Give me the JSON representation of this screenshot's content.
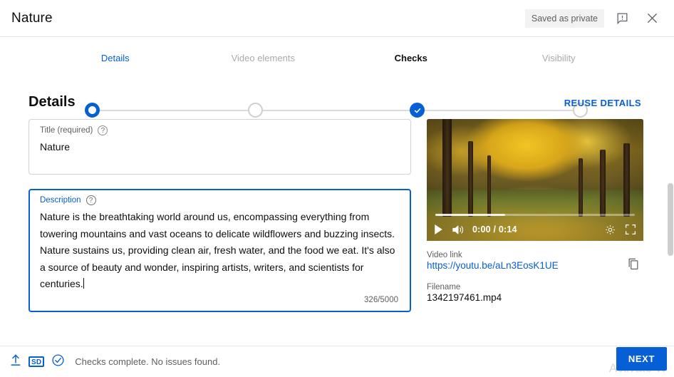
{
  "header": {
    "title": "Nature",
    "saved_badge": "Saved as private",
    "feedback_icon": "feedback-alert-icon",
    "close_icon": "close-icon"
  },
  "stepper": {
    "steps": [
      {
        "label": "Details",
        "state": "active"
      },
      {
        "label": "Video elements",
        "state": "todo"
      },
      {
        "label": "Checks",
        "state": "done"
      },
      {
        "label": "Visibility",
        "state": "todo"
      }
    ]
  },
  "details": {
    "section_title": "Details",
    "reuse_details": "REUSE DETAILS",
    "title_field": {
      "label": "Title (required)",
      "value": "Nature",
      "help": "?"
    },
    "description_field": {
      "label": "Description",
      "help": "?",
      "value": "Nature is the breathtaking world around us, encompassing everything from towering mountains and vast oceans to delicate wildflowers and buzzing insects. Nature sustains us, providing clean air, fresh water, and the food we eat. It's also a source of beauty and wonder, inspiring artists, writers, and scientists for centuries.",
      "char_count": "326/5000"
    }
  },
  "video": {
    "time_display": "0:00 / 0:14",
    "play_icon": "play-icon",
    "volume_icon": "volume-icon",
    "settings_icon": "gear-icon",
    "fullscreen_icon": "fullscreen-icon",
    "link_label": "Video link",
    "link_value": "https://youtu.be/aLn3EosK1UE",
    "copy_icon": "copy-icon",
    "filename_label": "Filename",
    "filename_value": "1342197461.mp4"
  },
  "footer": {
    "upload_icon": "upload-icon",
    "quality_badge": "SD",
    "check_icon": "check-circle-icon",
    "status": "Checks complete. No issues found.",
    "next_label": "NEXT",
    "watermark": "Activate W"
  },
  "colors": {
    "accent": "#065fd4",
    "text": "#0f0f0f",
    "muted": "#606060",
    "border": "#d3d3d3"
  }
}
